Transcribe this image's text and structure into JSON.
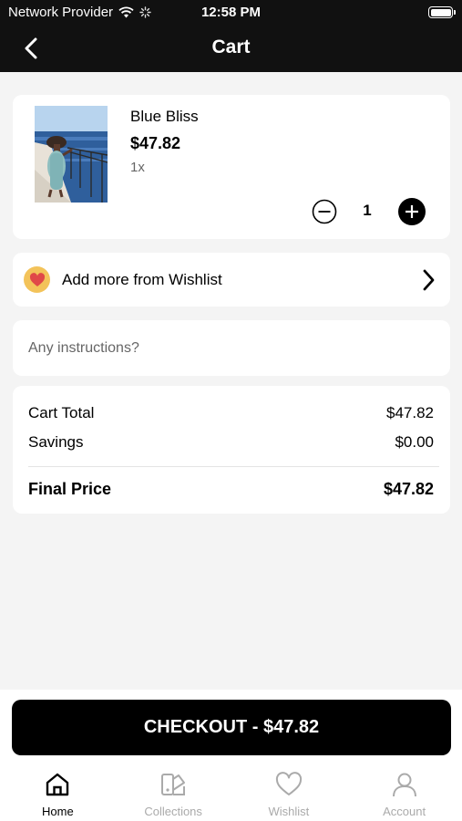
{
  "status_bar": {
    "carrier": "Network Provider",
    "time": "12:58 PM"
  },
  "nav": {
    "title": "Cart"
  },
  "cart_item": {
    "name": "Blue Bliss",
    "price": "$47.82",
    "quantity_label": "1x",
    "quantity": "1"
  },
  "wishlist_row": {
    "label": "Add more from Wishlist"
  },
  "instructions": {
    "placeholder": "Any instructions?"
  },
  "summary": {
    "cart_total_label": "Cart Total",
    "cart_total_value": "$47.82",
    "savings_label": "Savings",
    "savings_value": "$0.00",
    "final_label": "Final Price",
    "final_value": "$47.82"
  },
  "checkout": {
    "label": "CHECKOUT - $47.82"
  },
  "tabs": [
    {
      "label": "Home",
      "icon": "home-icon",
      "active": true
    },
    {
      "label": "Collections",
      "icon": "collections-icon",
      "active": false
    },
    {
      "label": "Wishlist",
      "icon": "heart-icon",
      "active": false
    },
    {
      "label": "Account",
      "icon": "account-icon",
      "active": false
    }
  ],
  "colors": {
    "header_bg": "#111111",
    "accent_heart_badge": "#f3c35a",
    "heart": "#e04848",
    "checkout_bg": "#000000"
  }
}
